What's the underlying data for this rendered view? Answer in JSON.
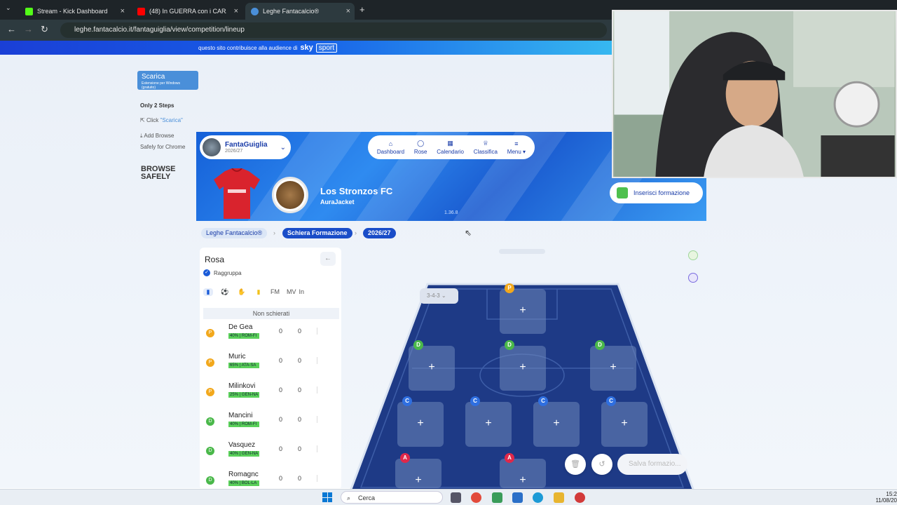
{
  "browser": {
    "tabs": [
      {
        "label": "Stream - Kick Dashboard",
        "color": "#53fc18"
      },
      {
        "label": "(48) In GUERRA con i CARABIN",
        "color": "#ff0000"
      },
      {
        "label": "Leghe Fantacalcio®",
        "color": "#4a8fd9"
      }
    ],
    "url": "leghe.fantacalcio.it/fantaguiglia/view/competition/lineup"
  },
  "sky_banner": {
    "text": "questo sito contribuisce alla audience di",
    "logo": "sky",
    "brand": "sport"
  },
  "ad": {
    "button": "Scarica",
    "button_sub": "Estensione per Windows (gratuito)",
    "steps_title": "Only 2 Steps",
    "step1_prefix": "Click ",
    "step1_link": "\"Scarica\"",
    "step2": "Add Browse",
    "step2b": "Safely for Chrome",
    "brand": "BROWSE SAFELY"
  },
  "header": {
    "user_name": "FantaGuiglia",
    "season": "2026/27",
    "nav": [
      "Dashboard",
      "Rose",
      "Calendario",
      "Classifica",
      "Menu"
    ],
    "team_name": "Los Stronzos FC",
    "team_owner": "AuraJacket",
    "version": "1.36.8",
    "insert_button": "Inserisci formazione"
  },
  "breadcrumb": [
    "Leghe Fantacalcio®",
    "Schiera Formazione",
    "2026/27"
  ],
  "rosa": {
    "title": "Rosa",
    "group_label": "Raggruppa",
    "columns": [
      "FM",
      "MV",
      "In"
    ],
    "section": "Non schierati",
    "players": [
      {
        "name": "De Gea",
        "info": "40% | ROM-FI",
        "role": "P",
        "fm": "0",
        "mv": "0"
      },
      {
        "name": "Muric",
        "info": "65% | ATA-SA",
        "role": "P",
        "fm": "0",
        "mv": "0"
      },
      {
        "name": "Milinkovi",
        "info": "25% | GEN-NA",
        "role": "P",
        "fm": "0",
        "mv": "0"
      },
      {
        "name": "Mancini",
        "info": "40% | ROM-FI",
        "role": "D",
        "fm": "0",
        "mv": "0"
      },
      {
        "name": "Vasquez",
        "info": "40% | GEN-NA",
        "role": "D",
        "fm": "0",
        "mv": "0"
      },
      {
        "name": "Romagnc",
        "info": "40% | BOL-LA",
        "role": "D",
        "fm": "0",
        "mv": "0"
      }
    ]
  },
  "pitch": {
    "formation": "3-4-3",
    "role_colors": {
      "P": "#f2a81c",
      "D": "#4ab84a",
      "C": "#2f6fe0",
      "A": "#e0284a"
    },
    "slots": [
      "P",
      "D",
      "D",
      "D",
      "C",
      "C",
      "C",
      "C",
      "A",
      "A"
    ]
  },
  "save_button": "Salva formazio...",
  "taskbar": {
    "search": "Cerca",
    "time": "15:2",
    "date": "11/08/20"
  }
}
